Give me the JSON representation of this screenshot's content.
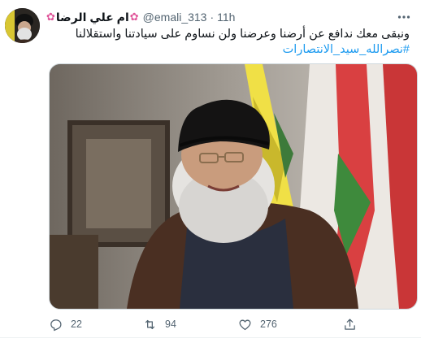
{
  "tweet": {
    "display_name": "ام علي الرضا",
    "name_emoji": "✿",
    "handle": "@emali_313",
    "separator": "·",
    "time": "11h",
    "text": "ونبقى معك ندافع عن أرضنا وعرضنا ولن نساوم على سيادتنا واستقلالنا",
    "hashtag": "#نصرالله_سيد_الانتصارات"
  },
  "actions": {
    "replies": "22",
    "retweets": "94",
    "likes": "276"
  },
  "icons": {
    "more": "more-horizontal-icon",
    "reply": "reply-icon",
    "retweet": "retweet-icon",
    "like": "heart-icon",
    "share": "share-icon"
  },
  "colors": {
    "link": "#1d9bf0",
    "secondary_text": "#536471",
    "flower": "#e0559a"
  }
}
